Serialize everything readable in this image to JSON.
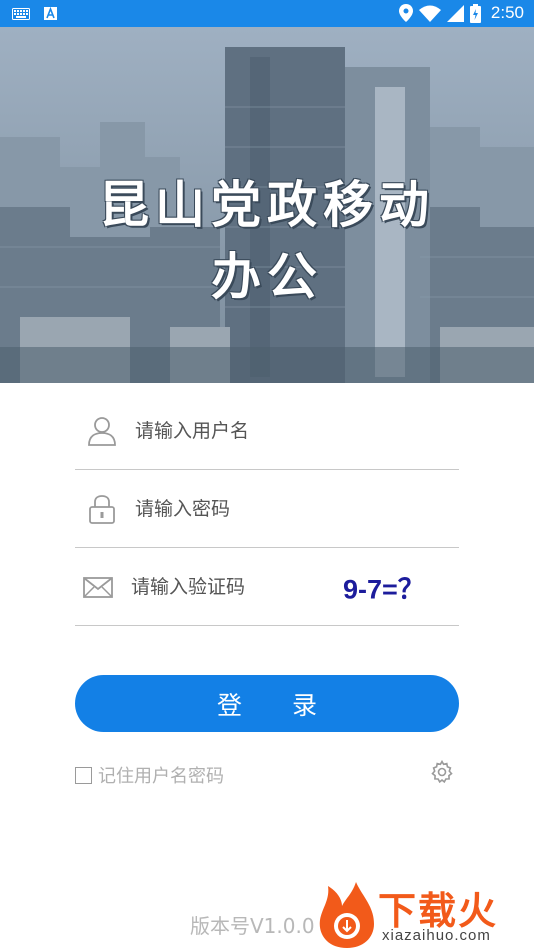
{
  "status_bar": {
    "time": "2:50",
    "left_icons": [
      "keyboard-icon",
      "a-notification-icon"
    ],
    "right_icons": [
      "location-icon",
      "wifi-icon",
      "signal-icon",
      "battery-icon"
    ]
  },
  "hero": {
    "title_line1": "昆山党政移动",
    "title_line2": "办公"
  },
  "form": {
    "username": {
      "placeholder": "请输入用户名",
      "value": "",
      "icon": "user-icon"
    },
    "password": {
      "placeholder": "请输入密码",
      "value": "",
      "icon": "lock-icon"
    },
    "captcha": {
      "placeholder": "请输入验证码",
      "value": "",
      "icon": "mail-icon",
      "challenge": "9-7=？"
    },
    "login_label": "登录",
    "remember_label": "记住用户名密码",
    "remember_checked": false
  },
  "footer": {
    "version": "版本号V1.0.0"
  },
  "watermark": {
    "brand": "下载火",
    "domain": "xiazaihuo.com"
  },
  "colors": {
    "status_bar": "#1a88e8",
    "button": "#1380e6",
    "captcha": "#1c1c9c",
    "watermark": "#f25a1a"
  }
}
